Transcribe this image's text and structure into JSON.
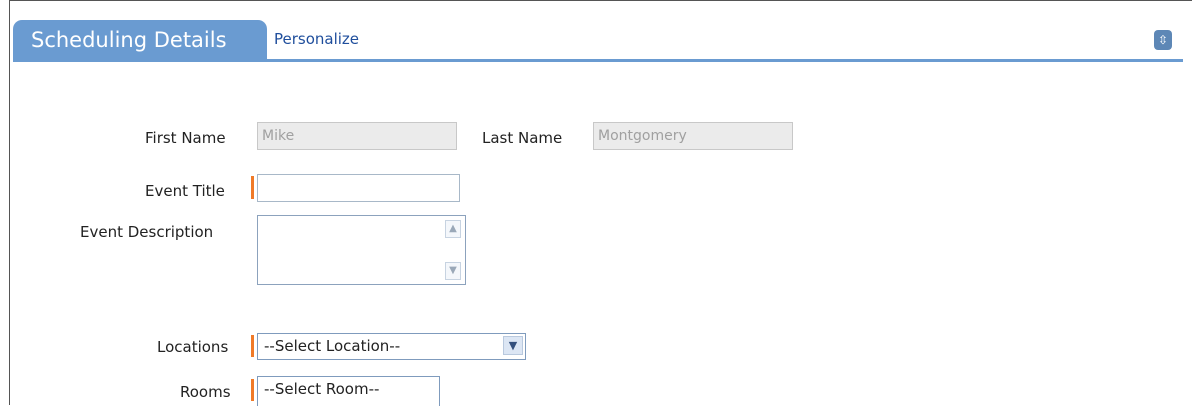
{
  "header": {
    "title": "Scheduling Details",
    "personalize": "Personalize",
    "collapse_icon": "collapse-icon"
  },
  "form": {
    "first_name_label": "First Name",
    "first_name_value": "Mike",
    "last_name_label": "Last Name",
    "last_name_value": "Montgomery",
    "event_title_label": "Event Title",
    "event_title_value": "",
    "event_description_label": "Event Description",
    "event_description_value": "",
    "locations_label": "Locations",
    "locations_selected": "--Select Location--",
    "rooms_label": "Rooms",
    "rooms_selected": "--Select Room--"
  },
  "colors": {
    "accent": "#6a9bd1",
    "required": "#f07a28",
    "link": "#1f4e9c"
  }
}
